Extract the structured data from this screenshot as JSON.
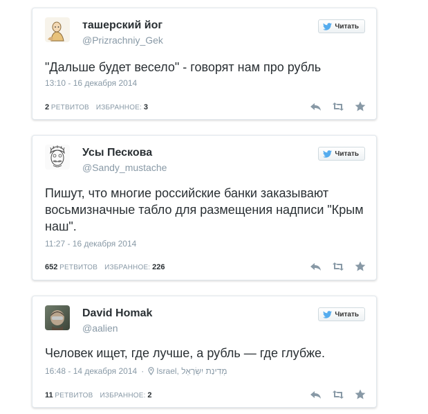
{
  "colors": {
    "text": "#292f33",
    "muted": "#8899a6",
    "twitter_blue": "#55acee",
    "action_gray": "#8899a6"
  },
  "tweets": [
    {
      "name": "ташерский йог",
      "handle": "@Prizrachniy_Gek",
      "follow_label": "Читать",
      "text": "\"Дальше будет весело\" - говорят нам про рубль",
      "timestamp": "13:10 - 16 декабря 2014",
      "retweets_count": "2",
      "retweets_label": "РЕТВИТОВ",
      "favorites_label": "ИЗБРАННОЕ:",
      "favorites_count": "3",
      "avatar_icon": "cartoon-avatar-icon"
    },
    {
      "name": "Усы Пескова",
      "handle": "@Sandy_mustache",
      "follow_label": "Читать",
      "text": "Пишут, что многие российские банки заказывают восьмизначные табло для размещения надписи \"Крым наш\".",
      "timestamp": "11:27 - 16 декабря 2014",
      "retweets_count": "652",
      "retweets_label": "РЕТВИТОВ",
      "favorites_label": "ИЗБРАННОЕ:",
      "favorites_count": "226",
      "avatar_icon": "sketch-face-avatar-icon"
    },
    {
      "name": "David Homak",
      "handle": "@aalien",
      "follow_label": "Читать",
      "text": "Человек ищет, где лучше, а рубль — где глубже.",
      "timestamp": "16:48 - 14 декабря 2014",
      "location": "Israel, מְדִינַת יִשְׂרָאֵל",
      "retweets_count": "11",
      "retweets_label": "РЕТВИТОВ",
      "favorites_label": "ИЗБРАННОЕ:",
      "favorites_count": "2",
      "avatar_icon": "photo-avatar-icon"
    }
  ]
}
